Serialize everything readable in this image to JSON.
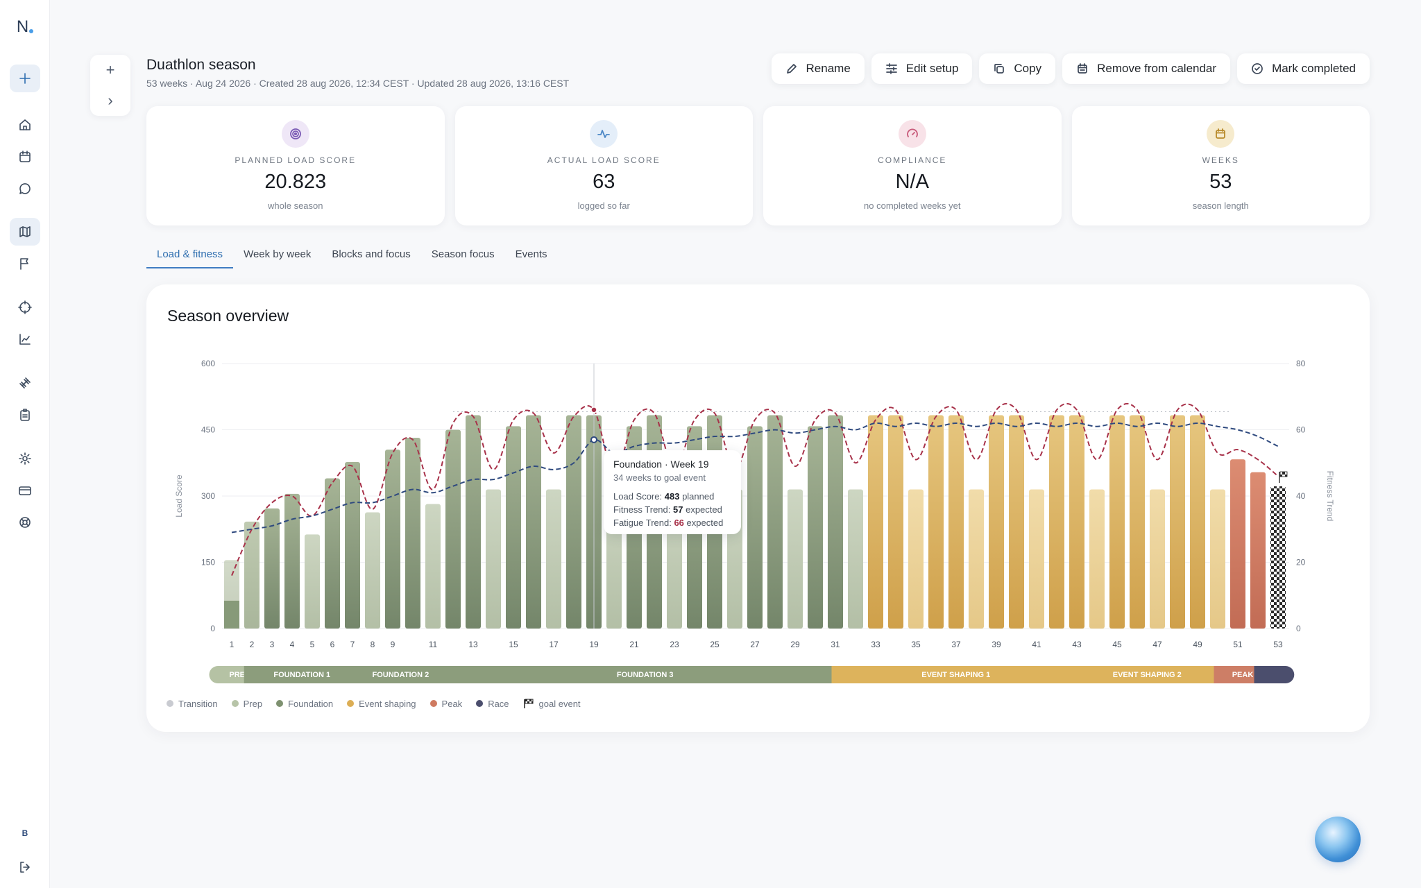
{
  "sidebar": {
    "logo": "N",
    "avatar": "B",
    "icons": [
      "plus-icon",
      "home-icon",
      "calendar-icon",
      "chat-icon",
      "map-icon",
      "flag-icon",
      "target-icon",
      "trend-icon",
      "dumbbell-icon",
      "clipboard-icon",
      "gear-icon",
      "card-icon",
      "lifebuoy-icon",
      "logout-icon"
    ]
  },
  "header": {
    "title": "Duathlon season",
    "subtitle": "53 weeks · Aug 24 2026 · Created 28 aug 2026, 12:34 CEST · Updated 28 aug 2026, 13:16 CEST",
    "actions": [
      {
        "label": "Rename",
        "icon": "pencil-icon"
      },
      {
        "label": "Edit setup",
        "icon": "sliders-icon"
      },
      {
        "label": "Copy",
        "icon": "copy-icon"
      },
      {
        "label": "Remove from calendar",
        "icon": "calendar-icon"
      },
      {
        "label": "Mark completed",
        "icon": "check-circle-icon"
      }
    ]
  },
  "stats": [
    {
      "label": "PLANNED LOAD SCORE",
      "value": "20.823",
      "caption": "whole season",
      "icon": "target-icon",
      "color": "#7b5bb5",
      "bg": "#efe7f7"
    },
    {
      "label": "ACTUAL LOAD SCORE",
      "value": "63",
      "caption": "logged so far",
      "icon": "pulse-icon",
      "color": "#4a86c5",
      "bg": "#e4eef9"
    },
    {
      "label": "COMPLIANCE",
      "value": "N/A",
      "caption": "no completed weeks yet",
      "icon": "gauge-icon",
      "color": "#c85a7a",
      "bg": "#f8e2e8"
    },
    {
      "label": "WEEKS",
      "value": "53",
      "caption": "season length",
      "icon": "calendar-icon",
      "color": "#b88a2a",
      "bg": "#f6ebcd"
    }
  ],
  "tabs": [
    "Load & fitness",
    "Week by week",
    "Blocks and focus",
    "Season focus",
    "Events"
  ],
  "active_tab": 0,
  "chart_title": "Season overview",
  "tooltip": {
    "title": "Foundation · Week 19",
    "subtitle": "34 weeks to goal event",
    "load_label": "Load Score:",
    "load_value": "483",
    "load_suffix": "planned",
    "fitness_label": "Fitness Trend:",
    "fitness_value": "57",
    "fitness_suffix": "expected",
    "fatigue_label": "Fatigue Trend:",
    "fatigue_value": "66",
    "fatigue_suffix": "expected"
  },
  "legend": [
    {
      "label": "Transition",
      "color": "#c9cbd1"
    },
    {
      "label": "Prep",
      "color": "#b7c4a8"
    },
    {
      "label": "Foundation",
      "color": "#7e9170"
    },
    {
      "label": "Event shaping",
      "color": "#dcae55"
    },
    {
      "label": "Peak",
      "color": "#cf7a60"
    },
    {
      "label": "Race",
      "color": "#4b4e6d"
    },
    {
      "label": "goal event",
      "color": "#222"
    }
  ],
  "blocks": [
    {
      "label": "PREP",
      "from": 1,
      "to": 2.3,
      "color": "#b5c2a4"
    },
    {
      "label": "FOUNDATION 1",
      "from": 2.3,
      "to": 7.2,
      "color": "#8c9d7c"
    },
    {
      "label": "FOUNDATION 2",
      "from": 7.2,
      "to": 12.1,
      "color": "#8c9d7c"
    },
    {
      "label": "FOUNDATION 3",
      "from": 12.1,
      "to": 31.5,
      "color": "#8c9d7c"
    },
    {
      "label": "EVENT SHAPING 1",
      "from": 31.5,
      "to": 43.0,
      "color": "#ddb35c"
    },
    {
      "label": "EVENT SHAPING 2",
      "from": 43.0,
      "to": 50.5,
      "color": "#ddb35c"
    },
    {
      "label": "PEAK",
      "from": 50.5,
      "to": 52.5,
      "color": "#cd7e66"
    },
    {
      "label": "",
      "from": 52.5,
      "to": 53.2,
      "color": "#4b4e6d"
    }
  ],
  "chart_data": {
    "type": "bar",
    "x": [
      1,
      2,
      3,
      4,
      5,
      6,
      7,
      8,
      9,
      10,
      11,
      12,
      13,
      14,
      15,
      16,
      17,
      18,
      19,
      20,
      21,
      22,
      23,
      24,
      25,
      26,
      27,
      28,
      29,
      30,
      31,
      32,
      33,
      34,
      35,
      36,
      37,
      38,
      39,
      40,
      41,
      42,
      43,
      44,
      45,
      46,
      47,
      48,
      49,
      50,
      51,
      52,
      53
    ],
    "x_tick_labels": [
      "1",
      "2",
      "3",
      "4",
      "5",
      "6",
      "7",
      "8",
      "9",
      "11",
      "13",
      "15",
      "17",
      "19",
      "21",
      "23",
      "25",
      "27",
      "29",
      "31",
      "33",
      "35",
      "37",
      "39",
      "41",
      "43",
      "45",
      "47",
      "49",
      "51",
      "53"
    ],
    "ylabel": "Load Score",
    "y2label": "Fitness Trend",
    "ylim": [
      0,
      600
    ],
    "y_ticks": [
      "0",
      "150",
      "300",
      "450",
      "600"
    ],
    "y2lim": [
      0,
      80
    ],
    "y2_ticks": [
      "0",
      "20",
      "40",
      "60",
      "80"
    ],
    "load_score": [
      155,
      242,
      272,
      305,
      213,
      340,
      377,
      263,
      405,
      432,
      282,
      450,
      483,
      315,
      458,
      483,
      315,
      483,
      483,
      315,
      458,
      483,
      315,
      458,
      483,
      315,
      458,
      483,
      315,
      458,
      483,
      315,
      483,
      483,
      315,
      483,
      483,
      315,
      483,
      483,
      315,
      483,
      483,
      315,
      483,
      483,
      315,
      483,
      483,
      315,
      383,
      354,
      322
    ],
    "actual_load": [
      63
    ],
    "phase": [
      "prep",
      "prep",
      "foundation",
      "foundation",
      "foundation",
      "foundation",
      "foundation",
      "foundation",
      "foundation",
      "foundation",
      "foundation",
      "foundation",
      "foundation",
      "foundation",
      "foundation",
      "foundation",
      "foundation",
      "foundation",
      "foundation",
      "foundation",
      "foundation",
      "foundation",
      "foundation",
      "foundation",
      "foundation",
      "foundation",
      "foundation",
      "foundation",
      "foundation",
      "foundation",
      "foundation",
      "foundation",
      "event",
      "event",
      "event",
      "event",
      "event",
      "event",
      "event",
      "event",
      "event",
      "event",
      "event",
      "event",
      "event",
      "event",
      "event",
      "event",
      "event",
      "event",
      "peak",
      "peak",
      "race"
    ],
    "fitness_trend": [
      29,
      30,
      31,
      33,
      34,
      36,
      38,
      38,
      40,
      42,
      41,
      43,
      45,
      45,
      47,
      49,
      48,
      50,
      57,
      53,
      55,
      56,
      56,
      57,
      58,
      58,
      59,
      60,
      59,
      60,
      61,
      60,
      62,
      61,
      62,
      61,
      62,
      61,
      62,
      61,
      62,
      61,
      62,
      61,
      62,
      61,
      62,
      61,
      62,
      61,
      60,
      58,
      55
    ],
    "fatigue_trend": [
      16,
      30,
      38,
      40,
      34,
      44,
      49,
      36,
      53,
      57,
      42,
      62,
      64,
      48,
      63,
      65,
      53,
      64,
      66,
      47,
      63,
      65,
      48,
      63,
      65,
      48,
      63,
      65,
      49,
      63,
      65,
      50,
      63,
      66,
      51,
      64,
      66,
      51,
      66,
      66,
      51,
      66,
      66,
      51,
      66,
      66,
      51,
      66,
      66,
      53,
      54,
      51,
      46
    ],
    "series": [
      {
        "name": "Load Score",
        "type": "bar"
      },
      {
        "name": "Fitness Trend",
        "type": "line",
        "color": "#2f4a7f"
      },
      {
        "name": "Fatigue Trend",
        "type": "line",
        "color": "#a8324a"
      }
    ],
    "highlight_week": 19,
    "colors": {
      "prep": "#b9c6ab",
      "foundation": "#829672",
      "event": "#dcae55",
      "peak": "#d07c62",
      "race": "#3a3a3a",
      "rest_foundation": "#c8d2bc",
      "rest_event": "#ecd39b"
    }
  }
}
